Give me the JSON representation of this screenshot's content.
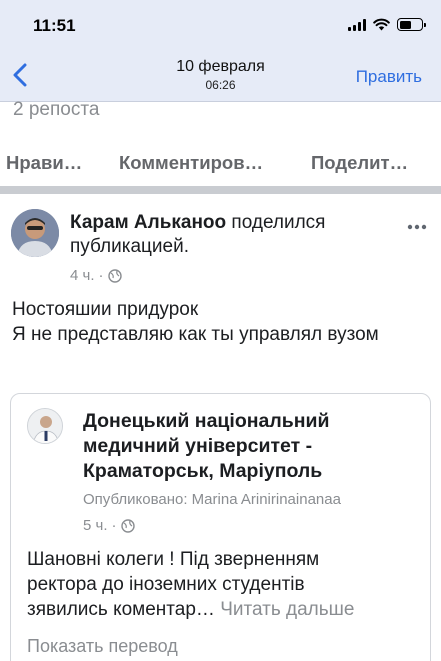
{
  "status_bar": {
    "time": "11:51"
  },
  "nav": {
    "date": "10 февраля",
    "time": "06:26",
    "edit_label": "Править"
  },
  "post": {
    "reposts": "2 репоста",
    "actions": [
      "Нрави…",
      "Комментиров…",
      "Поделит…"
    ],
    "author_name": "Карам Альканоо",
    "author_action": " поделился публикацией.",
    "time": "4 ч.",
    "dot": "·",
    "text_lines": [
      "Ностояшии придурок",
      "Я не представляю как ты управлял вузом"
    ]
  },
  "shared": {
    "page_lines": [
      "Донецький національний",
      "медичний університет -",
      "Краматорськ, Маріуполь"
    ],
    "published": "Опубликовано: Marina Arinirinainanaa",
    "time": "5 ч.",
    "dot": "·",
    "text_lines": [
      "Шановні колеги ! Під зверненням",
      "ректора до іноземних студентів",
      "зявились коментар…"
    ],
    "read_more": " Читать дальше",
    "translate": "Показать перевод"
  },
  "icons": {
    "back": "chevron-left-icon",
    "more": "more-horizontal-icon",
    "privacy": "globe-icon"
  },
  "colors": {
    "accent": "#2f6ee0",
    "nav_bg": "#e6ebf7",
    "secondary_text": "#8a8d91"
  }
}
